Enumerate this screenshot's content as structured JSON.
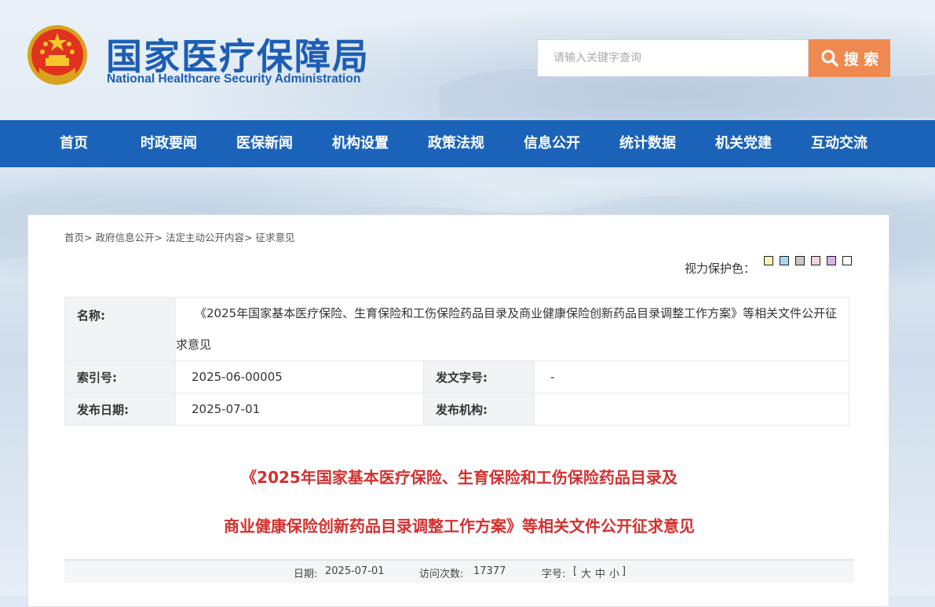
{
  "header": {
    "title_cn": "国家医疗保障局",
    "title_en": "National Healthcare Security Administration",
    "emblem_icon": "national-emblem-icon",
    "search_placeholder": "请输入关键字查询",
    "search_button": "搜 索",
    "search_icon": "magnifier-icon"
  },
  "nav": {
    "items": [
      {
        "label": "首页"
      },
      {
        "label": "时政要闻"
      },
      {
        "label": "医保新闻"
      },
      {
        "label": "机构设置"
      },
      {
        "label": "政策法规"
      },
      {
        "label": "信息公开"
      },
      {
        "label": "统计数据"
      },
      {
        "label": "机关党建"
      },
      {
        "label": "互动交流"
      }
    ],
    "color": "#1a63b9"
  },
  "breadcrumb": {
    "items": [
      "首页",
      "政府信息公开",
      "法定主动公开内容",
      "征求意见"
    ],
    "separator": ">"
  },
  "eye_protect": {
    "label": "视力保护色：",
    "colors": [
      "#f8f3b0",
      "#a9d8ee",
      "#c8c8c8",
      "#f6d1dc",
      "#d7b4ec",
      "#ffffff"
    ]
  },
  "info": {
    "name_label": "名称:",
    "name_value": "《2025年国家基本医疗保险、生育保险和工伤保险药品目录及商业健康保险创新药品目录调整工作方案》等相关文件公开征求意见",
    "index_label": "索引号:",
    "index_value": "2025-06-00005",
    "docno_label": "发文字号:",
    "docno_value": "-",
    "date_label": "发布日期:",
    "date_value": "2025-07-01",
    "org_label": "发布机构:",
    "org_value": ""
  },
  "doc": {
    "title_line1": "《2025年国家基本医疗保险、生育保险和工伤保险药品目录及",
    "title_line2": "商业健康保险创新药品目录调整工作方案》等相关文件公开征求意见",
    "title_color": "#d2312f"
  },
  "meta": {
    "date_label": "日期:",
    "date_value": "2025-07-01",
    "visits_label": "访问次数:",
    "visits_value": "17377",
    "font_label": "字号:",
    "font_open": "[",
    "font_large": "大",
    "font_medium": "中",
    "font_small": "小",
    "font_close": "]"
  }
}
